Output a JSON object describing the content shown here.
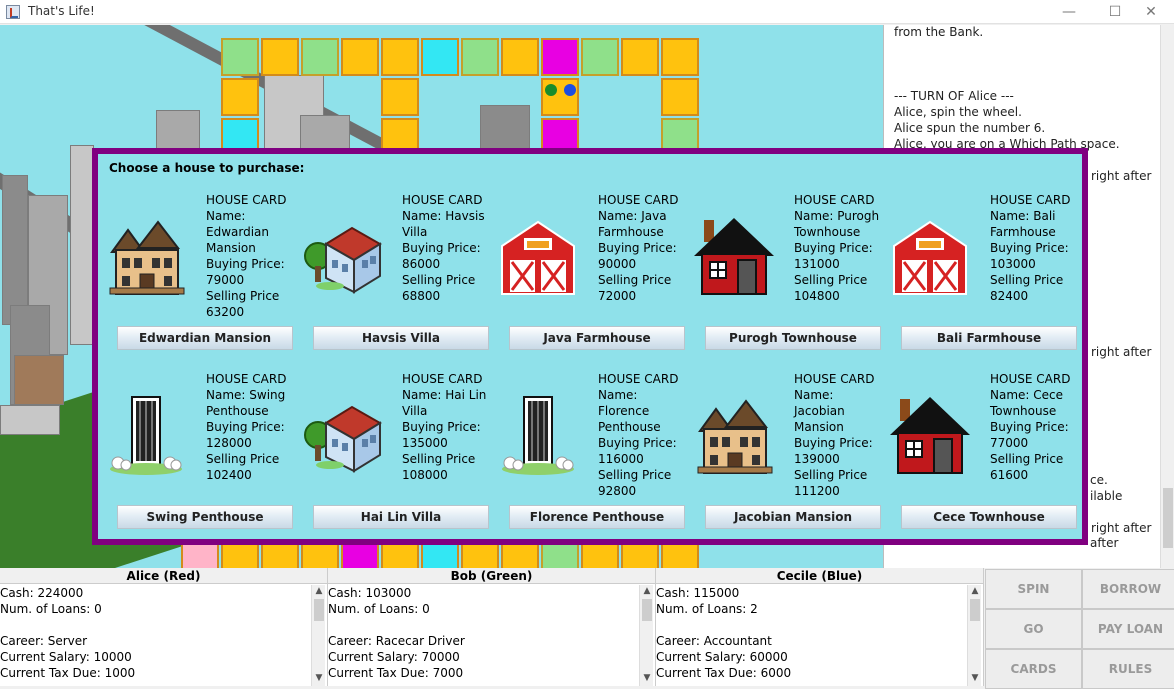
{
  "window": {
    "title": "That's Life!",
    "minimize": "—",
    "maximize": "☐",
    "close": "✕"
  },
  "log": {
    "lines": [
      "from the Bank.",
      "",
      "",
      "--- TURN OF Alice ---",
      "Alice, spin the wheel.",
      "Alice spun the number 6.",
      "Alice, you are on a Which Path space.",
      "right after",
      "right after",
      "ce.",
      "ilable",
      "right after",
      "after"
    ]
  },
  "dialog": {
    "prompt": "Choose a house to purchase:",
    "cards": [
      {
        "heading": "HOUSE CARD",
        "name": "Name: Edwardian Mansion",
        "buy_label": "Buying Price:",
        "buy": "79000",
        "sell_label": "Selling Price",
        "sell": "63200",
        "button": "Edwardian Mansion",
        "icon": "victorian-house-icon"
      },
      {
        "heading": "HOUSE CARD",
        "name": "Name: Havsis Villa",
        "buy_label": "Buying Price:",
        "buy": "86000",
        "sell_label": "Selling Price",
        "sell": "68800",
        "button": "Havsis Villa",
        "icon": "villa-icon"
      },
      {
        "heading": "HOUSE CARD",
        "name": "Name: Java Farmhouse",
        "buy_label": "Buying Price:",
        "buy": "90000",
        "sell_label": "Selling Price",
        "sell": "72000",
        "button": "Java Farmhouse",
        "icon": "barn-icon"
      },
      {
        "heading": "HOUSE CARD",
        "name": "Name: Purogh Townhouse",
        "buy_label": "Buying Price:",
        "buy": "131000",
        "sell_label": "Selling Price",
        "sell": "104800",
        "button": "Purogh Townhouse",
        "icon": "townhouse-icon"
      },
      {
        "heading": "HOUSE CARD",
        "name": "Name: Bali Farmhouse",
        "buy_label": "Buying Price:",
        "buy": "103000",
        "sell_label": "Selling Price",
        "sell": "82400",
        "button": "Bali Farmhouse",
        "icon": "barn-icon"
      },
      {
        "heading": "HOUSE CARD",
        "name": "Name: Swing Penthouse",
        "buy_label": "Buying Price:",
        "buy": "128000",
        "sell_label": "Selling Price",
        "sell": "102400",
        "button": "Swing Penthouse",
        "icon": "tower-icon"
      },
      {
        "heading": "HOUSE CARD",
        "name": "Name: Hai Lin Villa",
        "buy_label": "Buying Price:",
        "buy": "135000",
        "sell_label": "Selling Price",
        "sell": "108000",
        "button": "Hai Lin Villa",
        "icon": "villa-icon"
      },
      {
        "heading": "HOUSE CARD",
        "name": "Name: Florence Penthouse",
        "buy_label": "Buying Price:",
        "buy": "116000",
        "sell_label": "Selling Price",
        "sell": "92800",
        "button": "Florence Penthouse",
        "icon": "tower-icon"
      },
      {
        "heading": "HOUSE CARD",
        "name": "Name: Jacobian Mansion",
        "buy_label": "Buying Price:",
        "buy": "139000",
        "sell_label": "Selling Price",
        "sell": "111200",
        "button": "Jacobian Mansion",
        "icon": "victorian-house-icon"
      },
      {
        "heading": "HOUSE CARD",
        "name": "Name: Cece Townhouse",
        "buy_label": "Buying Price:",
        "buy": "77000",
        "sell_label": "Selling Price",
        "sell": "61600",
        "button": "Cece Townhouse",
        "icon": "townhouse-icon"
      }
    ]
  },
  "players": [
    {
      "header": "Alice (Red)",
      "cash": "Cash: 224000",
      "loans": "Num. of Loans: 0",
      "career": "Career: Server",
      "salary": "Current Salary: 10000",
      "tax": "Current Tax Due: 1000"
    },
    {
      "header": "Bob (Green)",
      "cash": "Cash: 103000",
      "loans": "Num. of Loans: 0",
      "career": "Career: Racecar Driver",
      "salary": "Current Salary: 70000",
      "tax": "Current Tax Due: 7000"
    },
    {
      "header": "Cecile (Blue)",
      "cash": "Cash: 115000",
      "loans": "Num. of Loans: 2",
      "career": "Career: Accountant",
      "salary": "Current Salary: 60000",
      "tax": "Current Tax Due: 6000"
    }
  ],
  "actions": {
    "spin": "SPIN",
    "borrow": "BORROW",
    "go": "GO",
    "pay_loan": "PAY LOAN",
    "cards": "CARDS",
    "rules": "RULES"
  },
  "pawns": [
    {
      "color": "#1a8c2a",
      "player": "Bob"
    },
    {
      "color": "#1c4ee0",
      "player": "Cecile"
    }
  ],
  "colors": {
    "dialog_border": "#800080",
    "board_bg": "#8fe1ea",
    "tile_yellow": "#ffc20e",
    "tile_green": "#8fe08a",
    "tile_cyan": "#33e7f3",
    "tile_magenta": "#e800e2"
  }
}
